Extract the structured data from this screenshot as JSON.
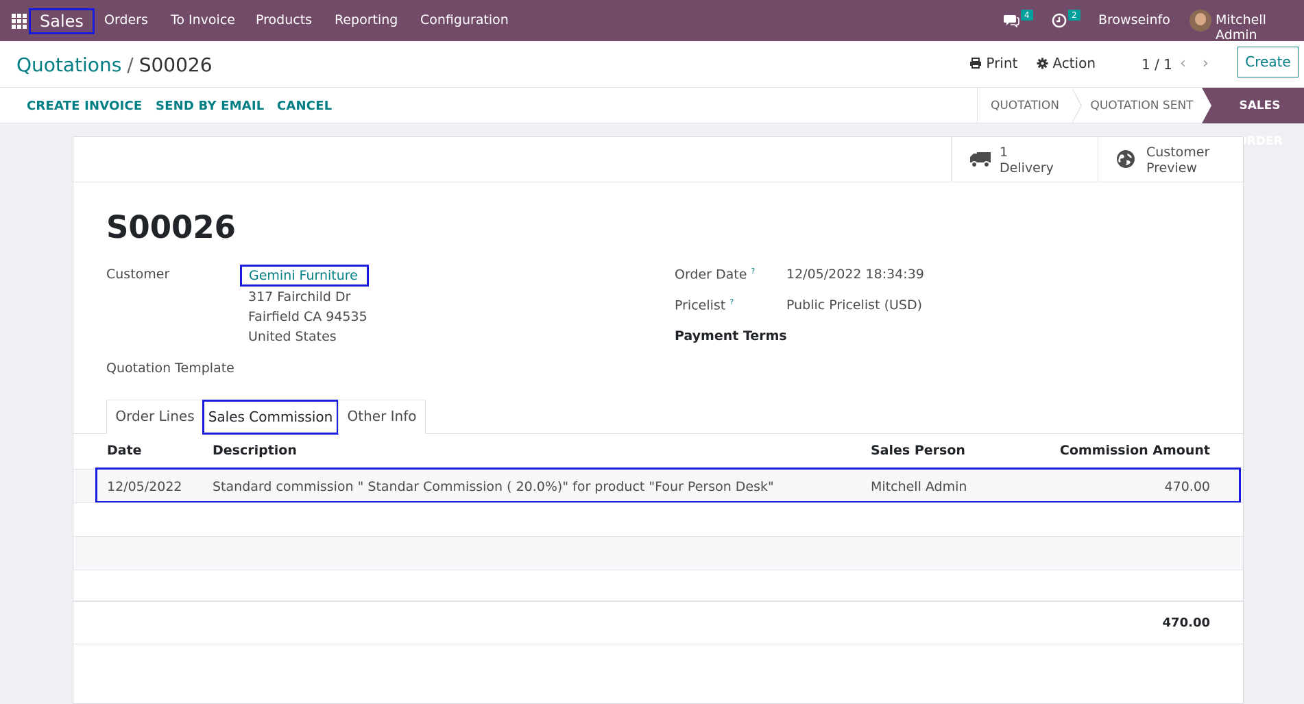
{
  "navbar": {
    "app_name": "Sales",
    "menu": [
      "Orders",
      "To Invoice",
      "Products",
      "Reporting",
      "Configuration"
    ],
    "messages_count": "4",
    "activities_count": "2",
    "company": "Browseinfo",
    "user": "Mitchell Admin"
  },
  "breadcrumb": {
    "parent": "Quotations",
    "separator": "/",
    "current": "S00026"
  },
  "control": {
    "print_label": "Print",
    "action_label": "Action",
    "pager": "1 / 1",
    "create_label": "Create"
  },
  "statusbar": {
    "actions": [
      "CREATE INVOICE",
      "SEND BY EMAIL",
      "CANCEL"
    ],
    "stages": [
      "QUOTATION",
      "QUOTATION SENT",
      "SALES ORDER"
    ],
    "active_stage": "SALES ORDER"
  },
  "smart_buttons": {
    "delivery": {
      "count": "1",
      "label": "Delivery"
    },
    "preview": {
      "line1": "Customer",
      "line2": "Preview"
    }
  },
  "form": {
    "title": "S00026",
    "customer_label": "Customer",
    "customer_name": "Gemini Furniture",
    "address": [
      "317 Fairchild Dr",
      "Fairfield CA 94535",
      "United States"
    ],
    "quotation_template_label": "Quotation Template",
    "order_date_label": "Order Date",
    "order_date": "12/05/2022 18:34:39",
    "pricelist_label": "Pricelist",
    "pricelist": "Public Pricelist (USD)",
    "payment_terms_label": "Payment Terms",
    "help_mark": "?"
  },
  "tabs": [
    "Order Lines",
    "Sales Commission",
    "Other Info"
  ],
  "active_tab": "Sales Commission",
  "commission_table": {
    "columns": [
      "Date",
      "Description",
      "Sales Person",
      "Commission Amount"
    ],
    "rows": [
      {
        "date": "12/05/2022",
        "description": "Standard commission \" Standar Commission ( 20.0%)\" for product \"Four Person Desk\"",
        "sales_person": "Mitchell Admin",
        "amount": "470.00"
      }
    ],
    "total": "470.00"
  },
  "colors": {
    "navbar": "#714b67",
    "link": "#017e84",
    "highlight_box": "#1a1cdd",
    "badge": "#00a09d"
  }
}
